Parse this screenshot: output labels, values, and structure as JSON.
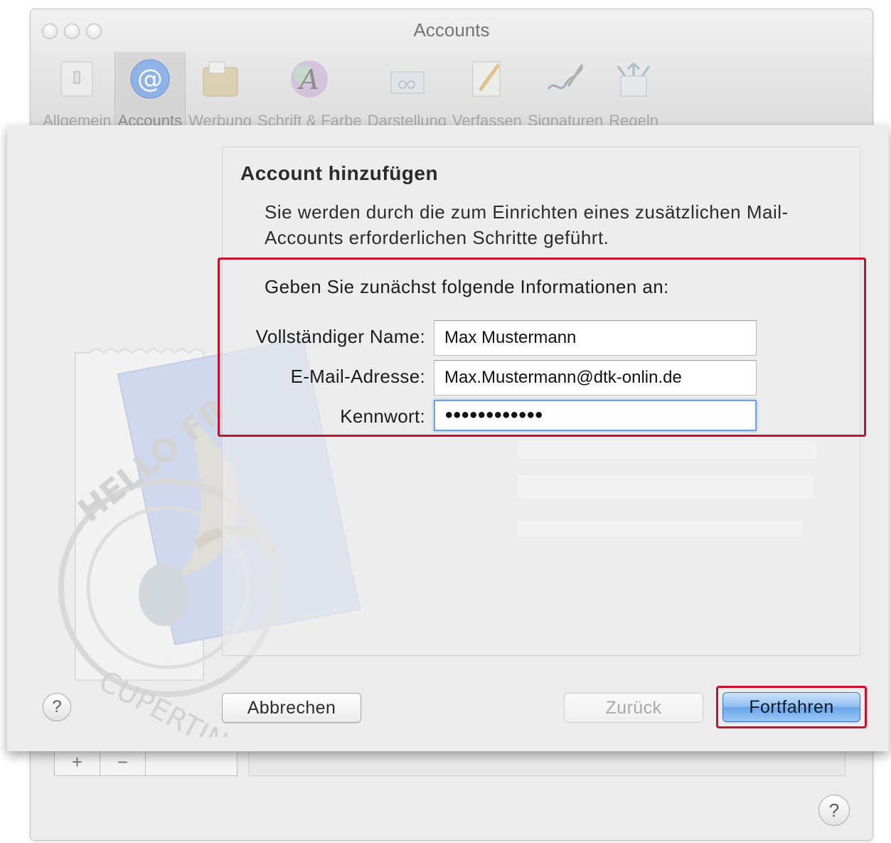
{
  "window": {
    "title": "Accounts",
    "toolbar": [
      {
        "label": "Allgemein",
        "icon": "switch-icon"
      },
      {
        "label": "Accounts",
        "icon": "at-sign-icon"
      },
      {
        "label": "Werbung",
        "icon": "junk-mail-icon"
      },
      {
        "label": "Schrift & Farbe",
        "icon": "font-color-icon"
      },
      {
        "label": "Darstellung",
        "icon": "viewing-icon"
      },
      {
        "label": "Verfassen",
        "icon": "compose-icon"
      },
      {
        "label": "Signaturen",
        "icon": "signature-icon"
      },
      {
        "label": "Regeln",
        "icon": "rules-icon"
      }
    ],
    "bottom_bar": {
      "add": "+",
      "remove": "−"
    },
    "help": "?"
  },
  "sheet": {
    "title": "Account hinzufügen",
    "description": "Sie werden durch die zum Einrichten eines zusätzlichen Mail-Accounts erforderlichen Schritte geführt.",
    "form_heading": "Geben Sie zunächst folgende Informationen an:",
    "fields": [
      {
        "label": "Vollständiger Name:",
        "value": "Max Mustermann"
      },
      {
        "label": "E-Mail-Adresse:",
        "value": "Max.Mustermann@dtk-onlin.de"
      },
      {
        "label": "Kennwort:",
        "value": "••••••••••••"
      }
    ],
    "stamp_text_top": "HELLO FR",
    "stamp_text_bottom": "CUPERTINO CA",
    "buttons": {
      "help": "?",
      "cancel": "Abbrechen",
      "back": "Zurück",
      "continue": "Fortfahren"
    }
  },
  "colors": {
    "highlight": "#c8102e",
    "primary_button": "#6aa5ea",
    "focus_ring": "#6ea3dc"
  }
}
